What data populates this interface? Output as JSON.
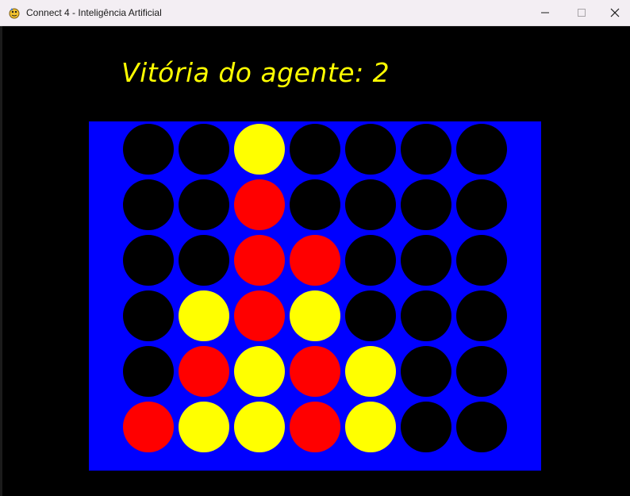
{
  "window": {
    "title": "Connect 4 - Inteligência Artificial",
    "icon": "pygame-snake-icon",
    "controls": [
      "minimize-icon",
      "maximize-icon",
      "close-icon"
    ]
  },
  "status": {
    "headline": "Vitória do agente: 2"
  },
  "colors": {
    "board": "#0000ff",
    "empty": "#000000",
    "red": "#ff0000",
    "yellow": "#ffff00",
    "text": "#ffff00"
  },
  "board": {
    "rows": 6,
    "cols": 7,
    "cells": [
      [
        "empty",
        "empty",
        "yellow",
        "empty",
        "empty",
        "empty",
        "empty"
      ],
      [
        "empty",
        "empty",
        "red",
        "empty",
        "empty",
        "empty",
        "empty"
      ],
      [
        "empty",
        "empty",
        "red",
        "red",
        "empty",
        "empty",
        "empty"
      ],
      [
        "empty",
        "yellow",
        "red",
        "yellow",
        "empty",
        "empty",
        "empty"
      ],
      [
        "empty",
        "red",
        "yellow",
        "red",
        "yellow",
        "empty",
        "empty"
      ],
      [
        "red",
        "yellow",
        "yellow",
        "red",
        "yellow",
        "empty",
        "empty"
      ]
    ]
  }
}
